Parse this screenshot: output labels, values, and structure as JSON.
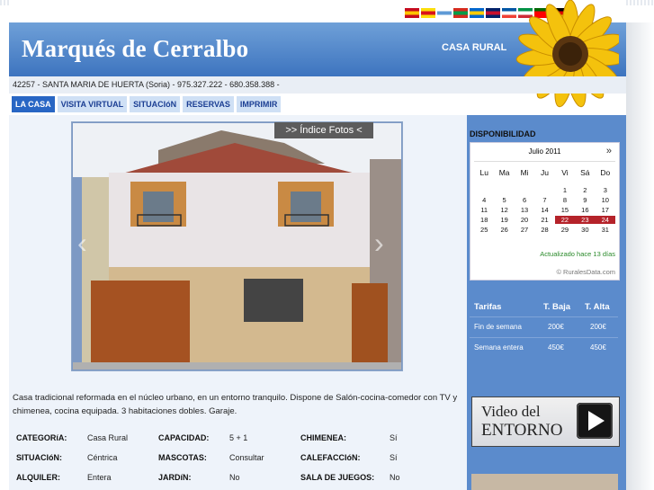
{
  "site": {
    "title": "Marqués de Cerralbo",
    "tagline": "CASA RURAL",
    "address": "42257 - SANTA MARIA DE HUERTA (Soria) - 975.327.222 - 680.358.388 -"
  },
  "languages": [
    {
      "name": "spanish-flag-icon",
      "colors": [
        "#c60b1e",
        "#ffc400",
        "#c60b1e"
      ]
    },
    {
      "name": "catalan-flag-icon",
      "colors": [
        "#fcdd09",
        "#da121a",
        "#fcdd09"
      ]
    },
    {
      "name": "galician-flag-icon",
      "colors": [
        "#ffffff",
        "#5e9ad6",
        "#ffffff"
      ]
    },
    {
      "name": "basque-flag-icon",
      "colors": [
        "#d52b1e",
        "#009b48",
        "#d52b1e"
      ]
    },
    {
      "name": "asturian-flag-icon",
      "colors": [
        "#0066cc",
        "#ffcc00",
        "#0066cc"
      ]
    },
    {
      "name": "uk-flag-icon",
      "colors": [
        "#012169",
        "#c8102e",
        "#012169"
      ]
    },
    {
      "name": "france-flag-icon",
      "colors": [
        "#0055a4",
        "#ffffff",
        "#ef4135"
      ]
    },
    {
      "name": "italy-flag-icon",
      "colors": [
        "#009246",
        "#ffffff",
        "#ce2b37"
      ]
    },
    {
      "name": "portugal-flag-icon",
      "colors": [
        "#006600",
        "#ff0000",
        "#ff0000"
      ]
    },
    {
      "name": "germany-flag-icon",
      "colors": [
        "#000000",
        "#dd0000",
        "#ffce00"
      ]
    }
  ],
  "nav": [
    {
      "label": "LA CASA",
      "active": true
    },
    {
      "label": "VISITA VIRTUAL"
    },
    {
      "label": "SITUACIóN"
    },
    {
      "label": "RESERVAS"
    },
    {
      "label": "IMPRIMIR"
    }
  ],
  "gallery": {
    "label": ">> Índice Fotos <"
  },
  "description": "Casa tradicional reformada en el núcleo urbano, en un entorno tranquilo. Dispone de Salón-cocina-comedor con TV y chimenea, cocina equipada. 3 habitaciones dobles. Garaje.",
  "facts": [
    [
      {
        "k": "CATEGORíA:",
        "v": "Casa Rural"
      },
      {
        "k": "CAPACIDAD:",
        "v": "5 + 1"
      },
      {
        "k": "CHIMENEA:",
        "v": "Sí"
      }
    ],
    [
      {
        "k": "SITUACIóN:",
        "v": "Céntrica"
      },
      {
        "k": "MASCOTAS:",
        "v": "Consultar"
      },
      {
        "k": "CALEFACCIóN:",
        "v": "Sí"
      }
    ],
    [
      {
        "k": "ALQUILER:",
        "v": "Entera"
      },
      {
        "k": "JARDíN:",
        "v": "No"
      },
      {
        "k": "SALA DE JUEGOS:",
        "v": "No"
      }
    ]
  ],
  "availability": {
    "title": "DISPONIBILIDAD",
    "month": "Julio 2011",
    "next": "»",
    "days": [
      "Lu",
      "Ma",
      "Mi",
      "Ju",
      "Vi",
      "Sá",
      "Do"
    ],
    "weeks": [
      [
        "",
        "",
        "",
        "",
        "1",
        "2",
        "3"
      ],
      [
        "4",
        "5",
        "6",
        "7",
        "8",
        "9",
        "10"
      ],
      [
        "11",
        "12",
        "13",
        "14",
        "15",
        "16",
        "17"
      ],
      [
        "18",
        "19",
        "20",
        "21",
        "22",
        "23",
        "24"
      ],
      [
        "25",
        "26",
        "27",
        "28",
        "29",
        "30",
        "31"
      ]
    ],
    "busy": [
      "22",
      "23",
      "24"
    ],
    "updated": "Actualizado hace 13 días",
    "footer": "© RuralesData.com",
    "busy_color": "#b5232a"
  },
  "rates": {
    "headers": [
      "Tarifas",
      "T. Baja",
      "T. Alta"
    ],
    "rows": [
      [
        "Fin de semana",
        "200€",
        "200€"
      ],
      [
        "Semana entera",
        "450€",
        "450€"
      ]
    ]
  },
  "video": {
    "line1": "Video del",
    "line2": "ENTORNO"
  },
  "colors": {
    "header": "#3d74bf",
    "nav_active": "#2866c4",
    "sidebar": "#5b8bcc"
  }
}
